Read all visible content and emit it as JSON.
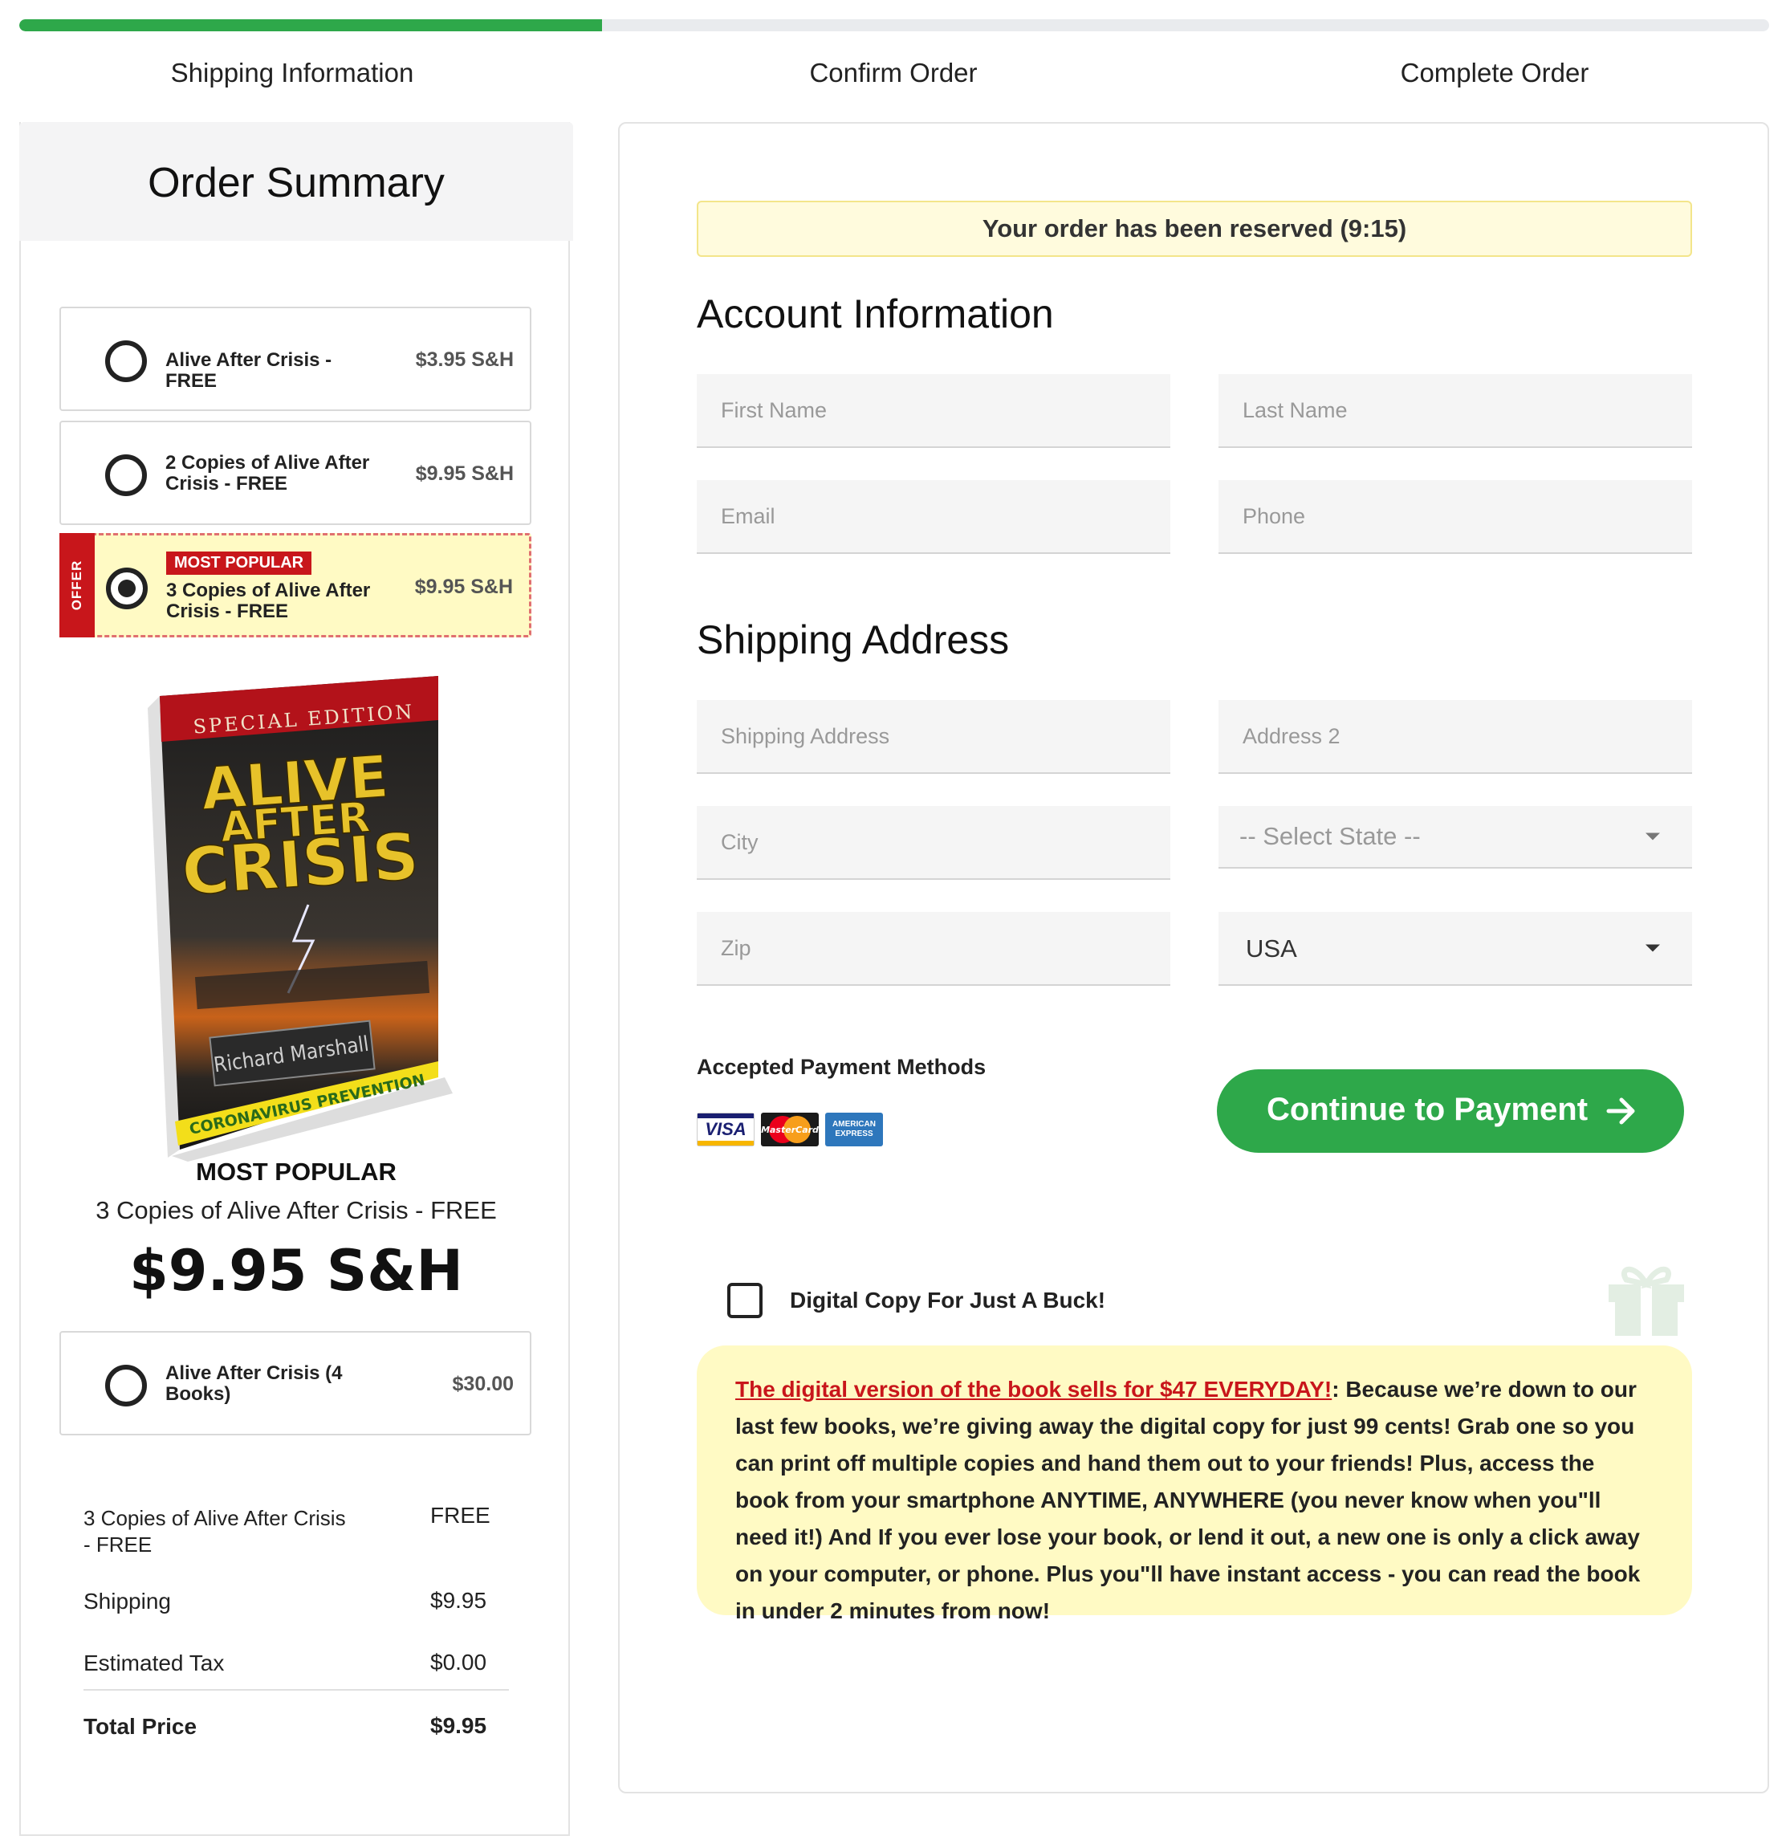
{
  "progress": {
    "fraction": 0.333
  },
  "steps": [
    {
      "label": "Shipping Information"
    },
    {
      "label": "Confirm Order"
    },
    {
      "label": "Complete Order"
    }
  ],
  "order_summary": {
    "title": "Order Summary",
    "offers": [
      {
        "title": "Alive After Crisis - FREE",
        "price": "$3.95 S&H",
        "selected": false
      },
      {
        "title": "2 Copies of Alive After Crisis - FREE",
        "price": "$9.95 S&H",
        "selected": false
      },
      {
        "title": "3 Copies of Alive After Crisis - FREE",
        "price": "$9.95 S&H",
        "selected": true,
        "tab": "OFFER",
        "badge": "MOST POPULAR"
      },
      {
        "title": "Alive After Crisis (4 Books)",
        "price": "$30.00",
        "selected": false
      }
    ],
    "book": {
      "top_band": "SPECIAL EDITION",
      "title_lines": [
        "ALIVE",
        "AFTER",
        "CRISIS"
      ],
      "author": "Richard Marshall",
      "bottom_band": "CORONAVIRUS PREVENTION"
    },
    "featured": {
      "label": "MOST POPULAR",
      "name": "3 Copies of Alive After Crisis - FREE",
      "price": "$9.95 S&H"
    },
    "lines": [
      {
        "label": "3 Copies of Alive After Crisis - FREE",
        "value": "FREE"
      },
      {
        "label": "Shipping",
        "value": "$9.95"
      },
      {
        "label": "Estimated Tax",
        "value": "$0.00"
      }
    ],
    "total": {
      "label": "Total Price",
      "value": "$9.95"
    }
  },
  "form": {
    "reserved_banner": "Your order has been reserved (9:15)",
    "account_title": "Account Information",
    "shipping_title": "Shipping Address",
    "placeholders": {
      "first_name": "First Name",
      "last_name": "Last Name",
      "email": "Email",
      "phone": "Phone",
      "address": "Shipping Address",
      "address2": "Address 2",
      "city": "City",
      "zip": "Zip"
    },
    "state_select": "-- Select State --",
    "country_select": "USA",
    "payment_methods_label": "Accepted Payment Methods",
    "cards": {
      "visa": "VISA",
      "mastercard": "MasterCard",
      "amex": "AMERICAN EXPRESS"
    },
    "continue_button": "Continue to Payment",
    "digital_copy": {
      "label": "Digital Copy For Just A Buck!",
      "checked": false,
      "promo_highlight": "The digital version of the book sells for $47 EVERYDAY!",
      "promo_text": ": Because we’re down to our last few books, we’re giving away the digital copy for just 99 cents! Grab one so you can print off multiple copies and hand them out to your friends! Plus, access the book from your smartphone ANYTIME, ANYWHERE (you never know when you\"ll need it!) And If you ever lose your book, or lend it out, a new one is only a click away on your computer, or phone. Plus you\"ll have instant access - you can read the book in under 2 minutes from now!"
    }
  },
  "colors": {
    "accent_green": "#2ea84a",
    "offer_red": "#c8161b",
    "highlight_yellow": "#fffac4",
    "banner_yellow": "#fffbdd"
  }
}
